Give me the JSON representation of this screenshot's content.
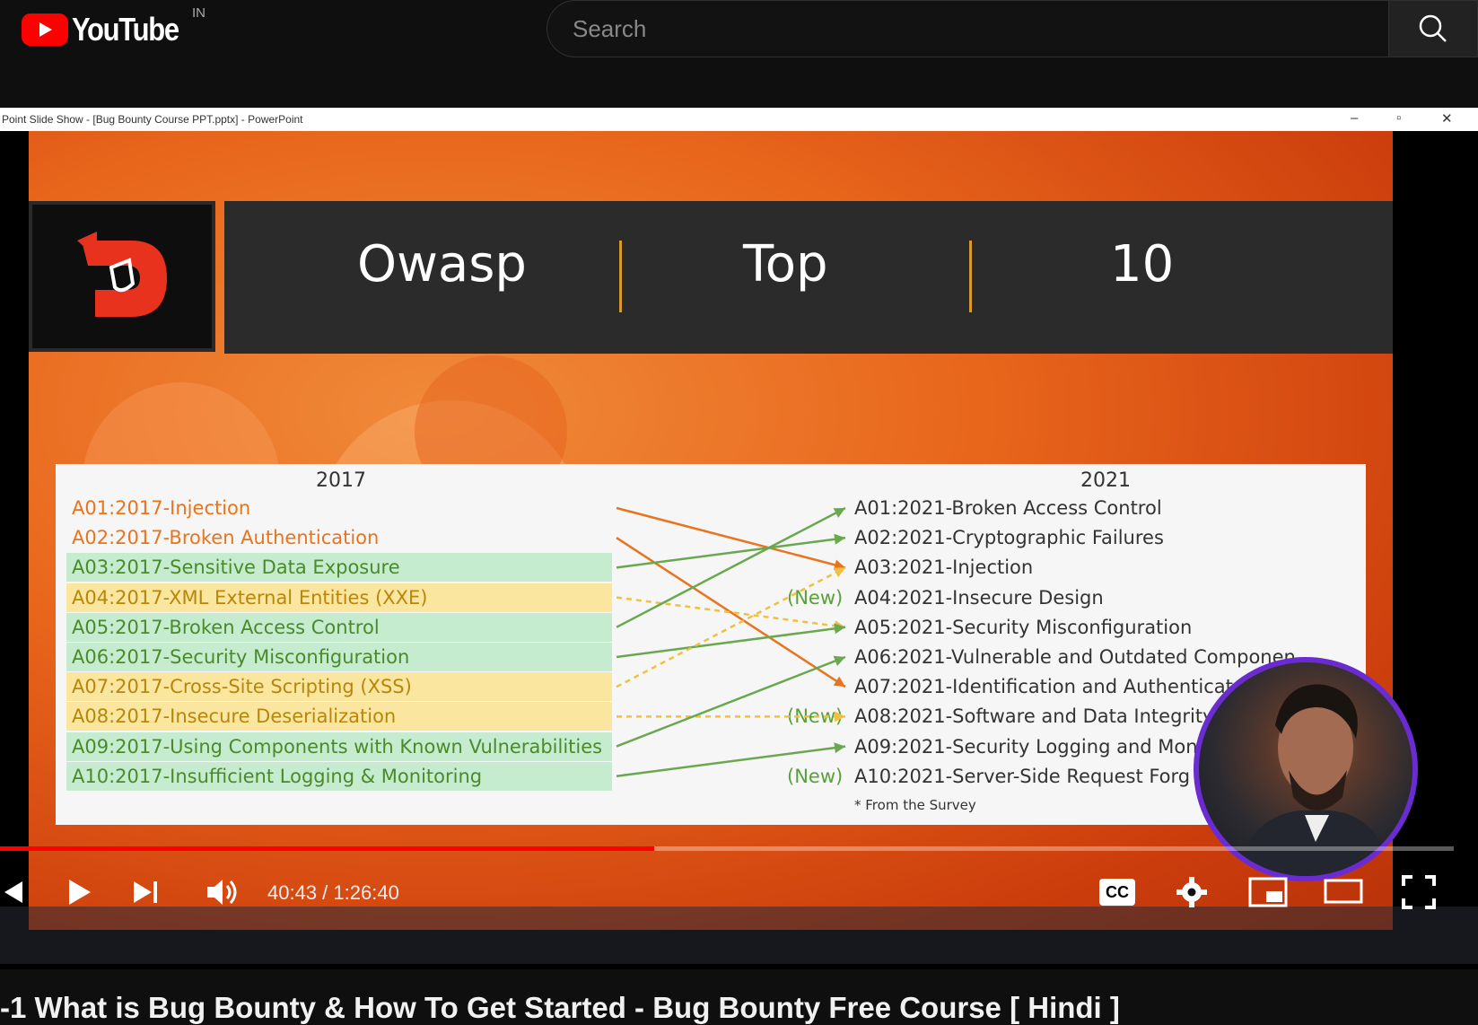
{
  "header": {
    "logo_text": "YouTube",
    "country": "IN",
    "search_placeholder": "Search"
  },
  "window": {
    "title": "Point Slide Show - [Bug Bounty Course PPT.pptx] - PowerPoint"
  },
  "slide": {
    "banner": [
      "Owasp",
      "Top",
      "10"
    ],
    "col_2017": "2017",
    "col_2021": "2021",
    "items_2017": [
      {
        "text": "A01:2017-Injection",
        "color": "#e8741e",
        "bg": "#f6f6f6"
      },
      {
        "text": "A02:2017-Broken Authentication",
        "color": "#e8741e",
        "bg": "#f6f6f6"
      },
      {
        "text": "A03:2017-Sensitive Data Exposure",
        "color": "#4a8a2a",
        "bg": "#c6ecd0"
      },
      {
        "text": "A04:2017-XML External Entities (XXE)",
        "color": "#b8860b",
        "bg": "#fbe6a0"
      },
      {
        "text": "A05:2017-Broken Access Control",
        "color": "#4a8a2a",
        "bg": "#c6ecd0"
      },
      {
        "text": "A06:2017-Security Misconfiguration",
        "color": "#4a8a2a",
        "bg": "#c6ecd0"
      },
      {
        "text": "A07:2017-Cross-Site Scripting (XSS)",
        "color": "#b8860b",
        "bg": "#fbe6a0"
      },
      {
        "text": "A08:2017-Insecure Deserialization",
        "color": "#b8860b",
        "bg": "#fbe6a0"
      },
      {
        "text": "A09:2017-Using Components with Known Vulnerabilities",
        "color": "#4a8a2a",
        "bg": "#c6ecd0"
      },
      {
        "text": "A10:2017-Insufficient Logging & Monitoring",
        "color": "#4a8a2a",
        "bg": "#c6ecd0"
      }
    ],
    "items_2021": [
      "A01:2021-Broken Access Control",
      "A02:2021-Cryptographic Failures",
      "A03:2021-Injection",
      "A04:2021-Insecure Design",
      "A05:2021-Security Misconfiguration",
      "A06:2021-Vulnerable and Outdated Componen",
      "A07:2021-Identification and Authenticat",
      "A08:2021-Software and Data Integrity",
      "A09:2021-Security Logging and Mon",
      "A10:2021-Server-Side Request Forg"
    ],
    "new_tag": "(New)",
    "footnote": "* From the Survey"
  },
  "player": {
    "current_time": "40:43",
    "separator": " / ",
    "duration": "1:26:40",
    "progress_fraction": 0.45,
    "cc_label": "CC",
    "taskbar_search": "Search"
  },
  "video": {
    "title": "-1 What is Bug Bounty & How To Get Started - Bug Bounty Free Course [ Hindi ]"
  },
  "colors": {
    "brand_red": "#ff0000",
    "accent_orange": "#e8741e",
    "accent_green": "#6aa84f",
    "avatar_ring": "#6a2bd1"
  }
}
